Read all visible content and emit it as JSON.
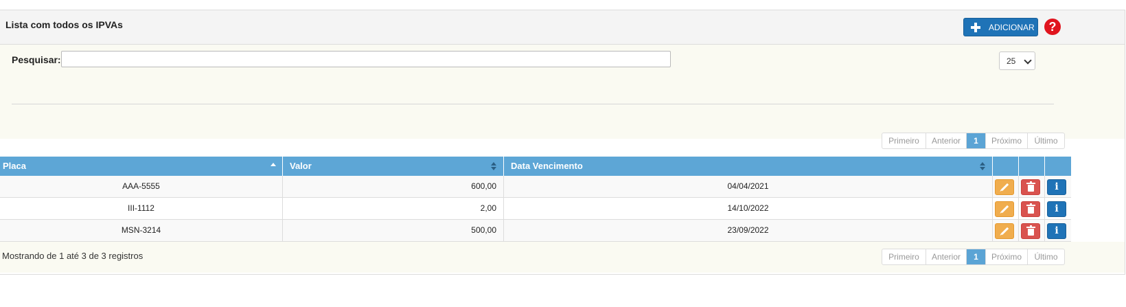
{
  "panel": {
    "title": "Lista com todos os IPVAs",
    "add_label": "ADICIONAR",
    "help_symbol": "?"
  },
  "filter": {
    "search_label": "Pesquisar:",
    "search_value": "",
    "page_size": "25"
  },
  "pagination": {
    "first": "Primeiro",
    "prev": "Anterior",
    "current": "1",
    "next": "Próximo",
    "last": "Último"
  },
  "table": {
    "headers": [
      "Placa",
      "Valor",
      "Data Vencimento"
    ],
    "rows": [
      {
        "placa": "AAA-5555",
        "valor": "600,00",
        "data": "04/04/2021"
      },
      {
        "placa": "III-1112",
        "valor": "2,00",
        "data": "14/10/2022"
      },
      {
        "placa": "MSN-3214",
        "valor": "500,00",
        "data": "23/09/2022"
      }
    ],
    "info_symbol": "i"
  },
  "footer": {
    "info": "Mostrando de 1 até 3 de 3 registros"
  },
  "colors": {
    "header_blue": "#5da6d6",
    "add_button": "#1f73b7",
    "edit_button": "#f0ad4e",
    "delete_button": "#d9534f",
    "help_red": "#e0141e",
    "filter_bg": "#fafaf2"
  },
  "icons": {
    "add": "plus-icon",
    "help": "question-circle-icon",
    "edit": "pencil-icon",
    "delete": "trash-icon",
    "info": "info-icon"
  }
}
